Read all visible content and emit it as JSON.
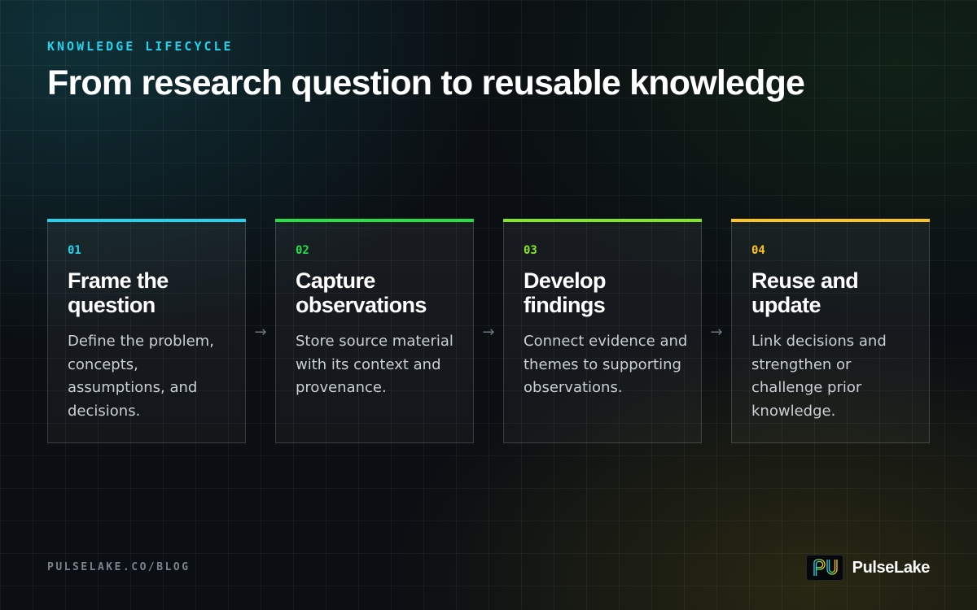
{
  "header": {
    "eyebrow": "KNOWLEDGE LIFECYCLE",
    "title": "From research question to reusable knowledge"
  },
  "steps": [
    {
      "number": "01",
      "title": "Frame the question",
      "description": "Define the problem, concepts, assumptions, and decisions.",
      "accent_color": "#22d3ee"
    },
    {
      "number": "02",
      "title": "Capture observations",
      "description": "Store source material with its context and provenance.",
      "accent_color": "#22e04a"
    },
    {
      "number": "03",
      "title": "Develop findings",
      "description": "Connect evidence and themes to supporting observations.",
      "accent_color": "#84e61e"
    },
    {
      "number": "04",
      "title": "Reuse and update",
      "description": "Link decisions and strengthen or challenge prior knowledge.",
      "accent_color": "#fbc51c"
    }
  ],
  "connector": {
    "symbol": "→"
  },
  "footer": {
    "url": "PULSELAKE.CO/BLOG",
    "brand_name": "PulseLake",
    "brand_icon": "pulselake-logo-icon"
  }
}
